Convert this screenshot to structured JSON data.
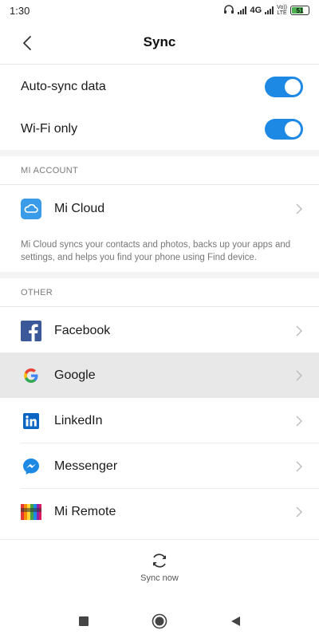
{
  "status_bar": {
    "time": "1:30",
    "network": "4G",
    "volte_top": "Vo))",
    "volte_bottom": "LTE",
    "battery_level": "51"
  },
  "header": {
    "title": "Sync"
  },
  "toggles": [
    {
      "label": "Auto-sync data",
      "enabled": true
    },
    {
      "label": "Wi-Fi only",
      "enabled": true
    }
  ],
  "mi_account": {
    "header": "MI ACCOUNT",
    "item": {
      "label": "Mi Cloud",
      "icon": "cloud-icon"
    },
    "description": "Mi Cloud syncs your contacts and photos, backs up your apps and settings, and helps you find your phone using Find device."
  },
  "other": {
    "header": "OTHER",
    "items": [
      {
        "label": "Facebook",
        "icon": "facebook-icon"
      },
      {
        "label": "Google",
        "icon": "google-icon"
      },
      {
        "label": "LinkedIn",
        "icon": "linkedin-icon"
      },
      {
        "label": "Messenger",
        "icon": "messenger-icon"
      },
      {
        "label": "Mi Remote",
        "icon": "mi-remote-icon"
      }
    ]
  },
  "bottom": {
    "sync_now": "Sync now"
  },
  "colors": {
    "accent": "#1e88e5",
    "facebook": "#3b5998",
    "linkedin": "#0a66c2",
    "messenger": "#1e88e5",
    "mi_cloud": "#3a9be8",
    "selected_row": "#e8e8e8"
  }
}
